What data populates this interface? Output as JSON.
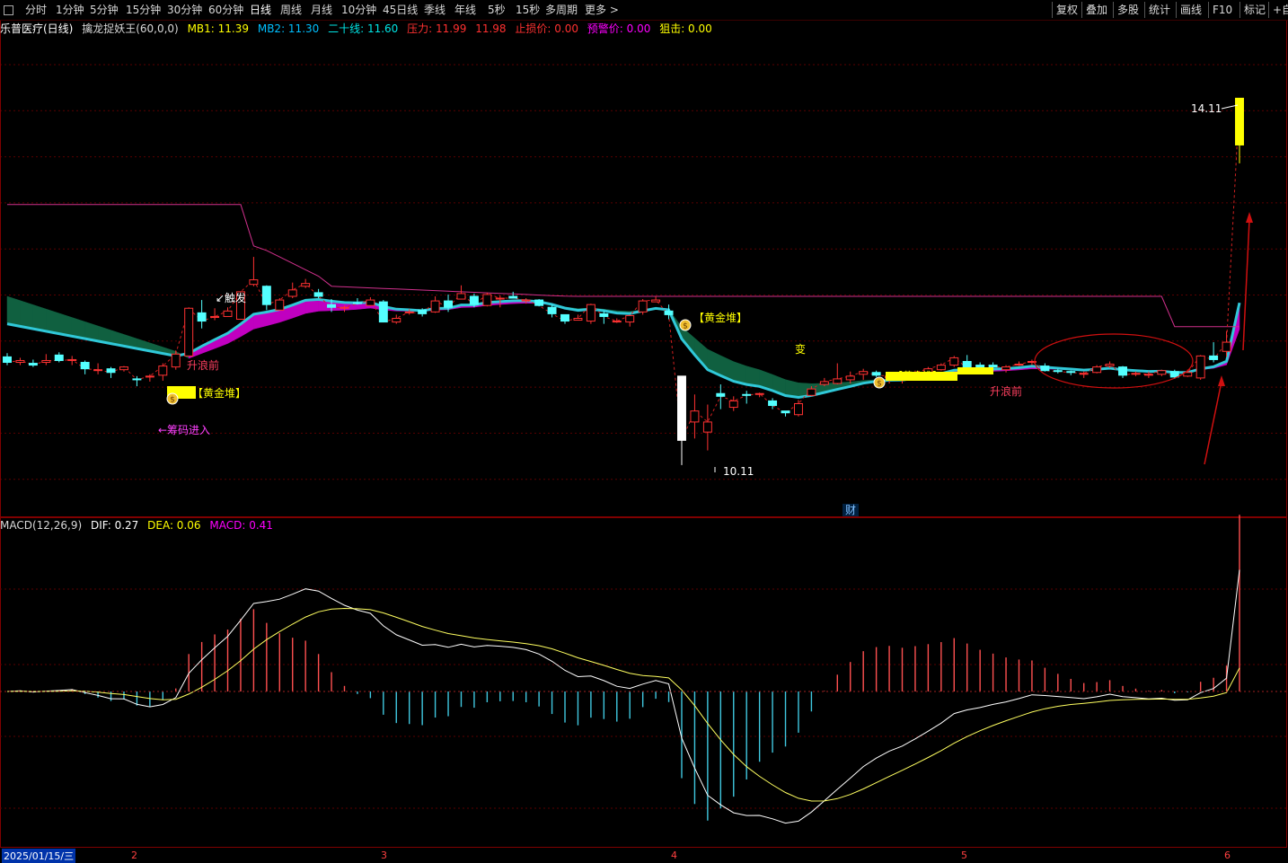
{
  "toolbar": {
    "periods": [
      "分时",
      "1分钟",
      "5分钟",
      "15分钟",
      "30分钟",
      "60分钟",
      "日线",
      "周线",
      "月线",
      "10分钟",
      "45日线",
      "季线",
      "年线",
      "5秒",
      "15秒",
      "多周期",
      "更多 >"
    ],
    "active_period": "日线",
    "right_buttons": [
      "复权",
      "叠加",
      "多股",
      "统计",
      "画线",
      "F10",
      "标记",
      "+自"
    ]
  },
  "main_header": {
    "stock": "乐普医疗(日线)",
    "indicator": "擒龙捉妖王(60,0,0)",
    "mb1": "MB1: 11.39",
    "mb2": "MB2: 11.30",
    "ershixian": "二十线: 11.60",
    "yali": "压力: 11.99",
    "yali2": "11.98",
    "zhisun": "止损价: 0.00",
    "yujing": "预警价: 0.00",
    "juji": "狙击: 0.00",
    "colors": {
      "mb1": "#ffff00",
      "mb2": "#00bfff",
      "ershixian": "#00e5e5",
      "yali": "#ff3030",
      "zhisun": "#ff3030",
      "yujing": "#ff00ff",
      "juji": "#ffff00"
    }
  },
  "annotations": {
    "high_price": "14.11",
    "low_price": "10.11",
    "golden_pile_1": "【黄金堆】",
    "golden_pile_2": "【黄金堆】",
    "golden_pile_3": "【黄金堆】",
    "chip_entry": "←筹码进入",
    "wave_before_1": "升浪前",
    "wave_before_2": "升浪前",
    "trigger": "触发",
    "change": "变",
    "cai": "财"
  },
  "macd_header": {
    "name": "MACD(12,26,9)",
    "dif": "DIF: 0.27",
    "dea": "DEA: 0.06",
    "macd": "MACD: 0.41"
  },
  "date_axis": {
    "current": "2025/01/15/三",
    "months": [
      "2",
      "3",
      "4",
      "5",
      "6"
    ]
  },
  "chart_data": {
    "type": "candlestick",
    "candles": [
      {
        "o": 11.29,
        "c": 11.23,
        "h": 11.33,
        "l": 11.2
      },
      {
        "o": 11.23,
        "c": 11.25,
        "h": 11.28,
        "l": 11.2
      },
      {
        "o": 11.22,
        "c": 11.2,
        "h": 11.26,
        "l": 11.18
      },
      {
        "o": 11.23,
        "c": 11.25,
        "h": 11.32,
        "l": 11.2
      },
      {
        "o": 11.31,
        "c": 11.25,
        "h": 11.34,
        "l": 11.23
      },
      {
        "o": 11.25,
        "c": 11.26,
        "h": 11.3,
        "l": 11.2
      },
      {
        "o": 11.23,
        "c": 11.16,
        "h": 11.25,
        "l": 11.1
      },
      {
        "o": 11.15,
        "c": 11.15,
        "h": 11.22,
        "l": 11.1
      },
      {
        "o": 11.16,
        "c": 11.12,
        "h": 11.18,
        "l": 11.06
      },
      {
        "o": 11.15,
        "c": 11.18,
        "h": 11.19,
        "l": 11.13
      },
      {
        "o": 11.05,
        "c": 11.04,
        "h": 11.08,
        "l": 10.97
      },
      {
        "o": 11.07,
        "c": 11.08,
        "h": 11.1,
        "l": 11.02
      },
      {
        "o": 11.09,
        "c": 11.19,
        "h": 11.22,
        "l": 11.03
      },
      {
        "o": 11.18,
        "c": 11.32,
        "h": 11.36,
        "l": 11.15
      },
      {
        "o": 11.3,
        "c": 11.82,
        "h": 11.83,
        "l": 11.3
      },
      {
        "o": 11.77,
        "c": 11.68,
        "h": 11.91,
        "l": 11.6
      },
      {
        "o": 11.72,
        "c": 11.73,
        "h": 11.82,
        "l": 11.69
      },
      {
        "o": 11.73,
        "c": 11.79,
        "h": 11.83,
        "l": 11.73
      },
      {
        "o": 11.7,
        "c": 12.0,
        "h": 12.0,
        "l": 11.7
      },
      {
        "o": 12.08,
        "c": 12.13,
        "h": 12.38,
        "l": 12.06
      },
      {
        "o": 12.06,
        "c": 11.86,
        "h": 12.07,
        "l": 11.8
      },
      {
        "o": 11.8,
        "c": 11.91,
        "h": 11.93,
        "l": 11.8
      },
      {
        "o": 11.95,
        "c": 12.02,
        "h": 12.1,
        "l": 11.93
      },
      {
        "o": 12.06,
        "c": 12.09,
        "h": 12.14,
        "l": 12.04
      },
      {
        "o": 11.99,
        "c": 11.95,
        "h": 12.03,
        "l": 11.93
      },
      {
        "o": 11.86,
        "c": 11.83,
        "h": 11.92,
        "l": 11.78
      },
      {
        "o": 11.82,
        "c": 11.83,
        "h": 11.85,
        "l": 11.78
      },
      {
        "o": 11.88,
        "c": 11.87,
        "h": 11.93,
        "l": 11.86
      },
      {
        "o": 11.85,
        "c": 11.91,
        "h": 11.94,
        "l": 11.84
      },
      {
        "o": 11.89,
        "c": 11.67,
        "h": 11.91,
        "l": 11.67
      },
      {
        "o": 11.67,
        "c": 11.71,
        "h": 11.75,
        "l": 11.65
      },
      {
        "o": 11.77,
        "c": 11.78,
        "h": 11.81,
        "l": 11.75
      },
      {
        "o": 11.8,
        "c": 11.76,
        "h": 11.82,
        "l": 11.73
      },
      {
        "o": 11.78,
        "c": 11.9,
        "h": 11.95,
        "l": 11.77
      },
      {
        "o": 11.9,
        "c": 11.83,
        "h": 11.97,
        "l": 11.78
      },
      {
        "o": 11.92,
        "c": 11.98,
        "h": 12.07,
        "l": 11.92
      },
      {
        "o": 11.95,
        "c": 11.86,
        "h": 11.98,
        "l": 11.83
      },
      {
        "o": 11.85,
        "c": 11.97,
        "h": 11.99,
        "l": 11.84
      },
      {
        "o": 11.93,
        "c": 11.93,
        "h": 11.96,
        "l": 11.83
      },
      {
        "o": 11.95,
        "c": 11.93,
        "h": 12.0,
        "l": 11.93
      },
      {
        "o": 11.9,
        "c": 11.91,
        "h": 11.93,
        "l": 11.87
      },
      {
        "o": 11.91,
        "c": 11.85,
        "h": 11.92,
        "l": 11.84
      },
      {
        "o": 11.83,
        "c": 11.76,
        "h": 11.86,
        "l": 11.72
      },
      {
        "o": 11.75,
        "c": 11.68,
        "h": 11.75,
        "l": 11.65
      },
      {
        "o": 11.69,
        "c": 11.71,
        "h": 11.75,
        "l": 11.69
      },
      {
        "o": 11.68,
        "c": 11.86,
        "h": 11.87,
        "l": 11.65
      },
      {
        "o": 11.76,
        "c": 11.73,
        "h": 11.79,
        "l": 11.65
      },
      {
        "o": 11.67,
        "c": 11.68,
        "h": 11.71,
        "l": 11.66
      },
      {
        "o": 11.67,
        "c": 11.74,
        "h": 11.75,
        "l": 11.62
      },
      {
        "o": 11.78,
        "c": 11.9,
        "h": 11.92,
        "l": 11.75
      },
      {
        "o": 11.89,
        "c": 11.91,
        "h": 11.95,
        "l": 11.89
      },
      {
        "o": 11.79,
        "c": 11.75,
        "h": 11.86,
        "l": 11.7
      },
      {
        "o": 11.08,
        "c": 10.38,
        "h": 11.08,
        "l": 10.11
      },
      {
        "o": 10.58,
        "c": 10.7,
        "h": 10.88,
        "l": 10.4
      },
      {
        "o": 10.47,
        "c": 10.58,
        "h": 10.77,
        "l": 10.27
      },
      {
        "o": 10.89,
        "c": 10.86,
        "h": 10.99,
        "l": 10.72
      },
      {
        "o": 10.74,
        "c": 10.81,
        "h": 10.86,
        "l": 10.7
      },
      {
        "o": 10.88,
        "c": 10.87,
        "h": 10.92,
        "l": 10.78
      },
      {
        "o": 10.89,
        "c": 10.89,
        "h": 10.9,
        "l": 10.85
      },
      {
        "o": 10.81,
        "c": 10.76,
        "h": 10.84,
        "l": 10.72
      },
      {
        "o": 10.7,
        "c": 10.68,
        "h": 10.7,
        "l": 10.64
      },
      {
        "o": 10.66,
        "c": 10.78,
        "h": 10.82,
        "l": 10.64
      },
      {
        "o": 10.87,
        "c": 10.94,
        "h": 10.97,
        "l": 10.86
      },
      {
        "o": 10.99,
        "c": 11.02,
        "h": 11.06,
        "l": 10.97
      },
      {
        "o": 11.0,
        "c": 11.05,
        "h": 11.22,
        "l": 10.99
      },
      {
        "o": 11.04,
        "c": 11.08,
        "h": 11.13,
        "l": 11.0
      },
      {
        "o": 11.1,
        "c": 11.13,
        "h": 11.16,
        "l": 11.04
      },
      {
        "o": 11.12,
        "c": 11.09,
        "h": 11.14,
        "l": 11.07
      },
      {
        "o": 11.06,
        "c": 11.08,
        "h": 11.11,
        "l": 11.0
      },
      {
        "o": 11.05,
        "c": 11.05,
        "h": 11.07,
        "l": 11.0
      },
      {
        "o": 11.1,
        "c": 11.12,
        "h": 11.14,
        "l": 11.05
      },
      {
        "o": 11.12,
        "c": 11.16,
        "h": 11.18,
        "l": 11.09
      },
      {
        "o": 11.15,
        "c": 11.2,
        "h": 11.22,
        "l": 11.14
      },
      {
        "o": 11.2,
        "c": 11.28,
        "h": 11.3,
        "l": 11.18
      },
      {
        "o": 11.24,
        "c": 11.17,
        "h": 11.31,
        "l": 11.13
      },
      {
        "o": 11.2,
        "c": 11.15,
        "h": 11.23,
        "l": 11.12
      },
      {
        "o": 11.2,
        "c": 11.18,
        "h": 11.23,
        "l": 11.15
      },
      {
        "o": 11.15,
        "c": 11.18,
        "h": 11.2,
        "l": 11.12
      },
      {
        "o": 11.21,
        "c": 11.21,
        "h": 11.24,
        "l": 11.19
      },
      {
        "o": 11.23,
        "c": 11.24,
        "h": 11.26,
        "l": 11.2
      },
      {
        "o": 11.19,
        "c": 11.14,
        "h": 11.22,
        "l": 11.13
      },
      {
        "o": 11.14,
        "c": 11.13,
        "h": 11.16,
        "l": 11.11
      },
      {
        "o": 11.13,
        "c": 11.12,
        "h": 11.14,
        "l": 11.09
      },
      {
        "o": 11.11,
        "c": 11.11,
        "h": 11.13,
        "l": 11.06
      },
      {
        "o": 11.12,
        "c": 11.18,
        "h": 11.2,
        "l": 11.11
      },
      {
        "o": 11.19,
        "c": 11.21,
        "h": 11.24,
        "l": 11.17
      },
      {
        "o": 11.18,
        "c": 11.09,
        "h": 11.19,
        "l": 11.06
      },
      {
        "o": 11.1,
        "c": 11.11,
        "h": 11.13,
        "l": 11.08
      },
      {
        "o": 11.1,
        "c": 11.1,
        "h": 11.13,
        "l": 11.06
      },
      {
        "o": 11.1,
        "c": 11.14,
        "h": 11.15,
        "l": 11.08
      },
      {
        "o": 11.13,
        "c": 11.07,
        "h": 11.15,
        "l": 11.05
      },
      {
        "o": 11.08,
        "c": 11.12,
        "h": 11.15,
        "l": 11.07
      },
      {
        "o": 11.06,
        "c": 11.3,
        "h": 11.31,
        "l": 11.04
      },
      {
        "o": 11.3,
        "c": 11.26,
        "h": 11.45,
        "l": 11.23
      },
      {
        "o": 11.35,
        "c": 11.45,
        "h": 11.57,
        "l": 11.29
      },
      {
        "o": 13.6,
        "c": 14.11,
        "h": 14.11,
        "l": 13.4
      }
    ],
    "ylim": [
      9.6,
      14.75
    ],
    "macd": {
      "name": "MACD(12,26,9)",
      "ylim": [
        -0.58,
        0.58
      ]
    }
  }
}
